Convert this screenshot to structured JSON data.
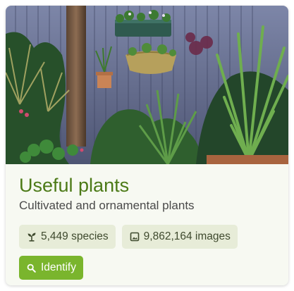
{
  "card": {
    "image_alt": "Potted plants against a painted fence",
    "title": "Useful plants",
    "subtitle": "Cultivated and ornamental plants",
    "species_count": "5,449 species",
    "images_count": "9,862,164 images",
    "identify_label": "Identify"
  },
  "colors": {
    "title": "#4c7a17",
    "badge_bg": "#e7ecd8",
    "button_bg": "#7ab52d",
    "card_bg": "#f7f9f2"
  },
  "icons": {
    "species": "sprout-icon",
    "images": "image-icon",
    "identify": "search-icon"
  }
}
